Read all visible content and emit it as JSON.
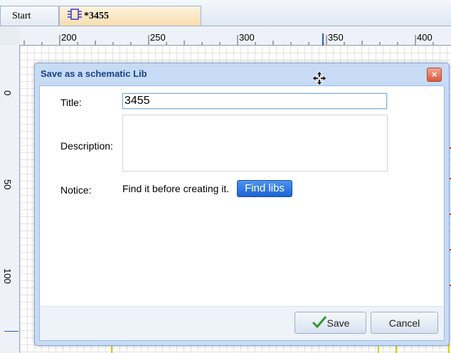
{
  "tabs": {
    "start_label": "Start",
    "doc_label": "*3455",
    "doc_icon": "schematic-chip-icon"
  },
  "ruler": {
    "h_labels": [
      "200",
      "250",
      "300",
      "350",
      "400"
    ],
    "v_labels": [
      "0",
      "50",
      "100"
    ]
  },
  "dialog": {
    "title": "Save as a schematic Lib",
    "close_label": "×",
    "title_label": "Title:",
    "title_value": "3455",
    "description_label": "Description:",
    "description_value": "",
    "notice_label": "Notice:",
    "notice_text": "Find it before creating it.",
    "find_libs_label": "Find libs",
    "save_label": "Save",
    "cancel_label": "Cancel"
  },
  "colors": {
    "accent": "#15428b",
    "find_button": "#1e63d6",
    "save_check": "#2e9a2e"
  }
}
